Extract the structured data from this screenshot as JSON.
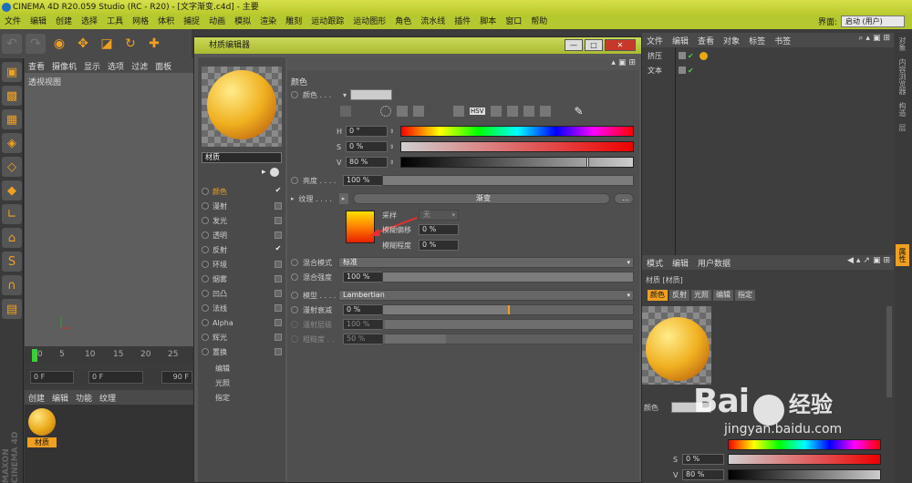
{
  "window": {
    "title": "CINEMA 4D R20.059 Studio (RC - R20) - [文字渐变.c4d] - 主要"
  },
  "menubar": {
    "items": [
      "文件",
      "编辑",
      "创建",
      "选择",
      "工具",
      "网格",
      "体积",
      "捕捉",
      "动画",
      "模拟",
      "渲染",
      "雕刻",
      "运动跟踪",
      "运动图形",
      "角色",
      "流水线",
      "插件",
      "脚本",
      "窗口",
      "帮助"
    ],
    "layout_label": "界面:",
    "layout_value": "启动 (用户)"
  },
  "viewport": {
    "menu": [
      "查看",
      "摄像机",
      "显示",
      "选项",
      "过滤",
      "面板"
    ],
    "label": "透视视图"
  },
  "timeline": {
    "ticks": [
      "0",
      "5",
      "10",
      "15",
      "20",
      "25"
    ],
    "start_frame": "0 F",
    "current_frame": "0 F",
    "end_frame": "90 F"
  },
  "material_manager": {
    "menu": [
      "创建",
      "编辑",
      "功能",
      "纹理"
    ],
    "material_name": "材质"
  },
  "brand": {
    "maxon": "MAXON CINEMA 4D"
  },
  "editor": {
    "title": "材质编辑器",
    "win_minimize": "—",
    "win_maximize": "□",
    "win_close": "✕",
    "material_name": "材质",
    "channels": [
      {
        "label": "颜色",
        "checked": true,
        "active": true
      },
      {
        "label": "漫射",
        "checked": false
      },
      {
        "label": "发光",
        "checked": false
      },
      {
        "label": "透明",
        "checked": false
      },
      {
        "label": "反射",
        "checked": true
      },
      {
        "label": "环境",
        "checked": false
      },
      {
        "label": "烟雾",
        "checked": false
      },
      {
        "label": "凹凸",
        "checked": false
      },
      {
        "label": "法线",
        "checked": false
      },
      {
        "label": "Alpha",
        "checked": false
      },
      {
        "label": "辉光",
        "checked": false
      },
      {
        "label": "置换",
        "checked": false
      }
    ],
    "extra_items": [
      "编辑",
      "光照",
      "指定"
    ],
    "section_title": "颜色",
    "color_label": "颜色 . . .",
    "hsv_label": "HSV",
    "h_label": "H",
    "h_value": "0 °",
    "s_label": "S",
    "s_value": "0 %",
    "v_label": "V",
    "v_value": "80 %",
    "v_level": 0.8,
    "brightness_label": "亮度 . . . .",
    "brightness_value": "100 %",
    "texture_label": "纹理 . . . .",
    "texture_name": "渐变",
    "texture_more": "...",
    "sampling_label": "采样",
    "sampling_value": "无",
    "blur_offset_label": "模糊偏移",
    "blur_offset_value": "0 %",
    "blur_scale_label": "模糊程度",
    "blur_scale_value": "0 %",
    "mix_mode_label": "混合模式",
    "mix_mode_value": "标准",
    "mix_strength_label": "混合强度",
    "mix_strength_value": "100 %",
    "model_label": "模型 . . . .",
    "model_value": "Lambertian",
    "diffuse_falloff_label": "漫射衰减",
    "diffuse_falloff_value": "0 %",
    "diffuse_level_label": "漫射层级",
    "diffuse_level_value": "100 %",
    "roughness_label": "粗糙度 . .",
    "roughness_value": "50 %"
  },
  "objects": {
    "menu": [
      "文件",
      "编辑",
      "查看",
      "对象",
      "标签",
      "书签"
    ],
    "rows": [
      {
        "name": "挤压"
      },
      {
        "name": "文本"
      }
    ]
  },
  "side_tabs": [
    "对象",
    "内容浏览器",
    "构造",
    "层"
  ],
  "attributes": {
    "menu": [
      "模式",
      "编辑",
      "用户数据"
    ],
    "title": "材质 [材质]",
    "tabs": [
      "颜色",
      "反射",
      "光照",
      "编辑",
      "指定"
    ],
    "color_label": "颜色",
    "s_label": "S",
    "s_value": "0 %",
    "v_label": "V",
    "v_value": "80 %",
    "side_tab": "属性"
  },
  "watermark": {
    "brand_left": "Bai",
    "brand_right": "经验",
    "url": "jingyan.baidu.com"
  },
  "colors": {
    "accent": "#f0a020",
    "titlebar": "#c9d858"
  }
}
